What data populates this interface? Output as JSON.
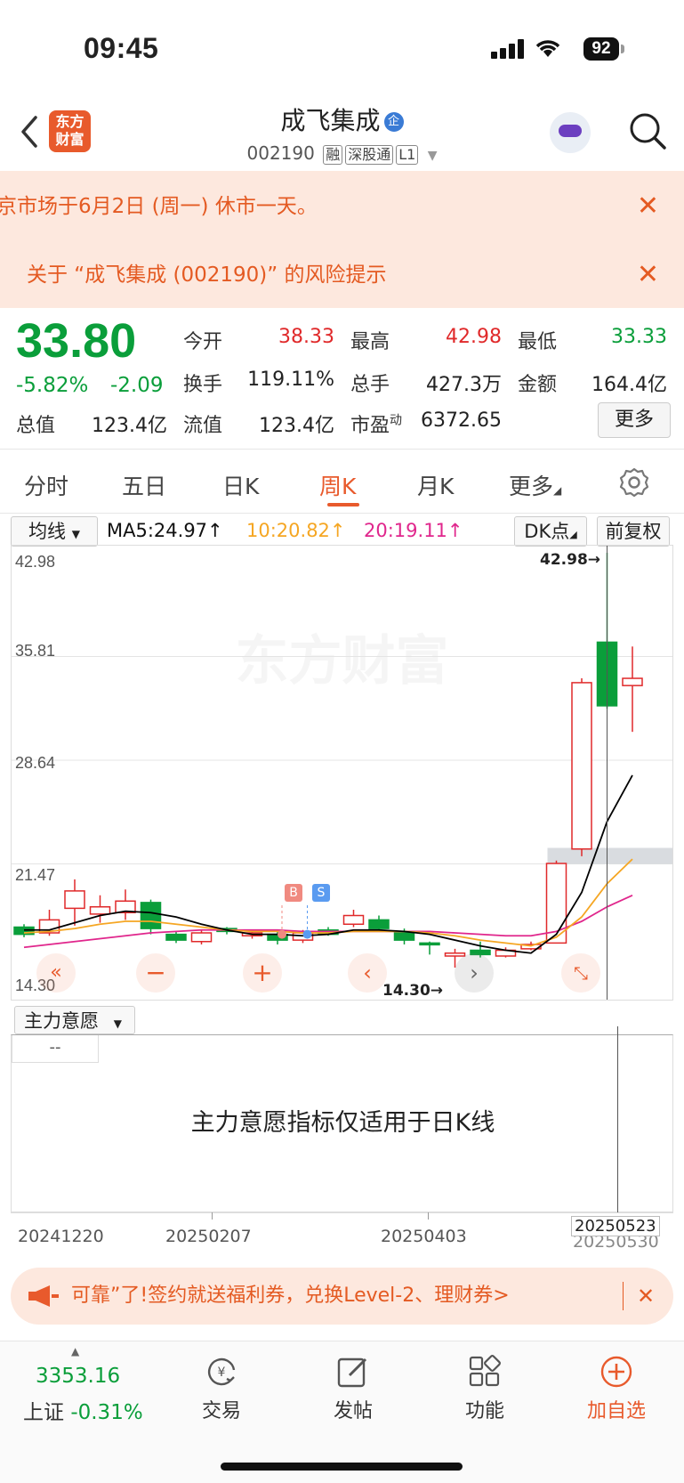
{
  "status": {
    "time": "09:45",
    "battery": "92"
  },
  "header": {
    "logo_line1": "东方",
    "logo_line2": "财富",
    "title": "成飞集成",
    "title_badge": "企",
    "code": "002190",
    "tags": [
      "融",
      "深股通",
      "L1"
    ]
  },
  "banners": [
    {
      "text": "京市场于6月2日 (周一) 休市一天。"
    },
    {
      "text": "关于 “成飞集成 (002190)” 的风险提示"
    }
  ],
  "quote": {
    "price": "33.80",
    "change_pct": "-5.82%",
    "change": "-2.09",
    "fields": [
      {
        "label": "今开",
        "value": "38.33",
        "color": "red"
      },
      {
        "label": "最高",
        "value": "42.98",
        "color": "red"
      },
      {
        "label": "最低",
        "value": "33.33",
        "color": "green"
      },
      {
        "label": "换手",
        "value": "119.11%",
        "color": "black"
      },
      {
        "label": "总手",
        "value": "427.3万",
        "color": "black"
      },
      {
        "label": "金额",
        "value": "164.4亿",
        "color": "black"
      },
      {
        "label": "总值",
        "value": "123.4亿",
        "color": "black"
      },
      {
        "label": "流值",
        "value": "123.4亿",
        "color": "black"
      },
      {
        "label": "市盈",
        "sup": "动",
        "value": "6372.65",
        "color": "black"
      }
    ],
    "more_label": "更多"
  },
  "tabs": [
    "分时",
    "五日",
    "日K",
    "周K",
    "月K",
    "更多"
  ],
  "active_tab": "周K",
  "ma": {
    "select": "均线",
    "ma5": "MA5:24.97",
    "ma10": "10:20.82",
    "ma20": "20:19.11",
    "dk": "DK点",
    "fq": "前复权",
    "colors": {
      "ma5": "#000000",
      "ma10": "#f5a623",
      "ma20": "#e0268c"
    }
  },
  "chart_data": {
    "type": "candlestick",
    "y_ticks": [
      "42.98",
      "35.81",
      "28.64",
      "21.47",
      "14.30"
    ],
    "ylim": [
      14.3,
      42.98
    ],
    "high_label": "42.98→",
    "low_label": "14.30→",
    "watermark": "东方财富",
    "markers": [
      "B",
      "S"
    ],
    "candles": [
      {
        "o": 17.1,
        "c": 16.6,
        "h": 17.3,
        "l": 16.4
      },
      {
        "o": 16.7,
        "c": 17.6,
        "h": 18.3,
        "l": 16.5
      },
      {
        "o": 18.4,
        "c": 19.6,
        "h": 20.4,
        "l": 17.2
      },
      {
        "o": 18.0,
        "c": 18.5,
        "h": 19.3,
        "l": 17.4
      },
      {
        "o": 18.1,
        "c": 18.9,
        "h": 19.7,
        "l": 17.6
      },
      {
        "o": 18.8,
        "c": 17.0,
        "h": 19.0,
        "l": 16.6
      },
      {
        "o": 16.6,
        "c": 16.2,
        "h": 16.8,
        "l": 16.0
      },
      {
        "o": 16.1,
        "c": 16.7,
        "h": 16.9,
        "l": 15.9
      },
      {
        "o": 17.0,
        "c": 16.8,
        "h": 17.1,
        "l": 16.6
      },
      {
        "o": 16.5,
        "c": 16.7,
        "h": 16.8,
        "l": 16.3
      },
      {
        "o": 16.6,
        "c": 16.2,
        "h": 16.8,
        "l": 15.9
      },
      {
        "o": 16.2,
        "c": 16.7,
        "h": 16.9,
        "l": 16.0
      },
      {
        "o": 16.9,
        "c": 16.6,
        "h": 17.1,
        "l": 16.5
      },
      {
        "o": 17.3,
        "c": 17.9,
        "h": 18.3,
        "l": 17.1
      },
      {
        "o": 17.6,
        "c": 17.0,
        "h": 17.9,
        "l": 16.8
      },
      {
        "o": 16.8,
        "c": 16.2,
        "h": 17.0,
        "l": 15.9
      },
      {
        "o": 16.0,
        "c": 15.9,
        "h": 16.1,
        "l": 15.2
      },
      {
        "o": 15.1,
        "c": 15.3,
        "h": 15.6,
        "l": 14.3
      },
      {
        "o": 15.5,
        "c": 15.2,
        "h": 16.1,
        "l": 15.0
      },
      {
        "o": 15.1,
        "c": 15.5,
        "h": 15.7,
        "l": 15.0
      },
      {
        "o": 15.6,
        "c": 15.9,
        "h": 16.1,
        "l": 15.5
      },
      {
        "o": 16.0,
        "c": 21.5,
        "h": 21.7,
        "l": 16.0
      },
      {
        "o": 22.5,
        "c": 34.0,
        "h": 34.3,
        "l": 22.0
      },
      {
        "o": 36.8,
        "c": 32.4,
        "h": 42.98,
        "l": 32.2
      },
      {
        "o": 33.8,
        "c": 34.3,
        "h": 36.5,
        "l": 30.6
      }
    ],
    "ma5": [
      16.9,
      16.9,
      17.4,
      17.9,
      18.2,
      18.1,
      17.8,
      17.3,
      16.9,
      16.6,
      16.6,
      16.5,
      16.6,
      16.9,
      16.9,
      16.8,
      16.6,
      16.2,
      15.8,
      15.5,
      15.3,
      16.6,
      19.5,
      24.4,
      27.6
    ],
    "ma10": [
      16.7,
      16.8,
      17.0,
      17.3,
      17.5,
      17.5,
      17.3,
      17.1,
      16.9,
      16.8,
      16.8,
      16.7,
      16.7,
      16.8,
      16.8,
      16.8,
      16.7,
      16.5,
      16.2,
      16.0,
      15.8,
      16.4,
      17.8,
      20.1,
      21.8
    ],
    "ma20": [
      15.7,
      15.9,
      16.1,
      16.3,
      16.5,
      16.7,
      16.8,
      16.9,
      16.9,
      16.9,
      16.9,
      16.8,
      16.8,
      16.8,
      16.8,
      16.8,
      16.8,
      16.7,
      16.6,
      16.5,
      16.5,
      16.8,
      17.5,
      18.5,
      19.3
    ]
  },
  "indicator": {
    "select": "主力意愿",
    "value": "--",
    "message": "主力意愿指标仅适用于日K线"
  },
  "x_axis": {
    "labels": [
      "20241220",
      "20250207",
      "20250403",
      "20250530"
    ],
    "cursor_date": "20250523"
  },
  "promo": {
    "text": "可靠”了!签约就送福利券，兑换Level-2、理财券>"
  },
  "bottom_nav": {
    "index_value": "3353.16",
    "index_name": "上证",
    "index_change": "-0.31%",
    "items": [
      "交易",
      "发帖",
      "功能",
      "加自选"
    ]
  }
}
